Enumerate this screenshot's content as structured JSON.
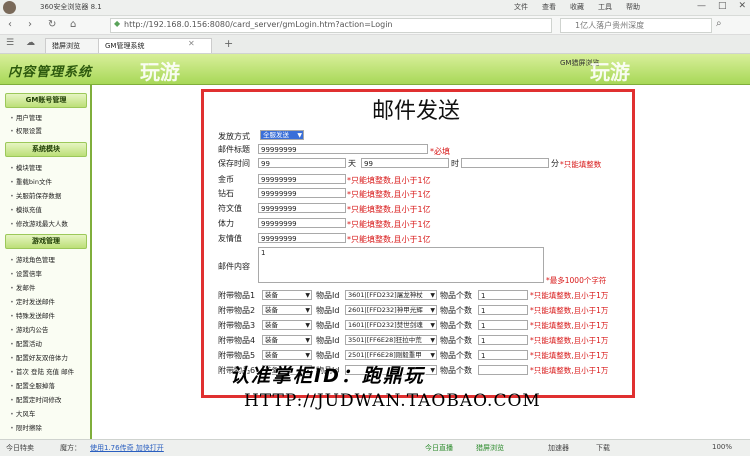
{
  "browser": {
    "title": "360安全浏览器 8.1",
    "menu": [
      "文件",
      "查看",
      "收藏",
      "工具",
      "帮助"
    ],
    "window_controls": [
      "—",
      "□",
      "✕"
    ],
    "url": "http://192.168.0.156:8080/card_server/gmLogin.htm?action=Login",
    "search_placeholder": "1亿人落户贵州深度",
    "tabs": [
      {
        "label": "猎屏浏览"
      },
      {
        "label": "GM管理系统"
      }
    ],
    "new_tab": "+",
    "tab_close": "✕",
    "nav": [
      "‹",
      "›",
      "↻"
    ]
  },
  "header": {
    "title": "内容管理系统",
    "right_text": "GM猎屏浏览",
    "watermark_left": "玩游",
    "watermark_right": "玩游"
  },
  "sidebar": {
    "sections": [
      {
        "title": "GM账号管理",
        "items": [
          "用户管理",
          "权限设置"
        ]
      },
      {
        "title": "系统模块",
        "items": [
          "模块管理",
          "重载bin文件",
          "关服前保存数据",
          "模拟充值",
          "修改游戏最大人数"
        ]
      },
      {
        "title": "游戏管理",
        "items": [
          "游戏角色管理",
          "设置倍率",
          "发邮件",
          "定时发送邮件",
          "特殊发送邮件",
          "游戏内公告",
          "配置活动",
          "配置好友双倍体力",
          "首次 登陆 充值 邮件",
          "配置全服掉落",
          "配置定时间修改",
          "大风车",
          "限时擦除"
        ]
      }
    ]
  },
  "form": {
    "title": "邮件发送",
    "send_mode": {
      "label": "发放方式",
      "value": "全服发送"
    },
    "subject": {
      "label": "邮件标题",
      "value": "99999999",
      "note": "*必填"
    },
    "duration": {
      "label": "保存时间",
      "days": "99",
      "days_unit": "天",
      "hours": "99",
      "hours_unit": "时",
      "minutes": "",
      "minutes_unit": "分",
      "note": "*只能填整数"
    },
    "fields": [
      {
        "label": "金币",
        "value": "99999999",
        "note": "*只能填整数,且小于1亿"
      },
      {
        "label": "钻石",
        "value": "99999999",
        "note": "*只能填整数,且小于1亿"
      },
      {
        "label": "符文值",
        "value": "99999999",
        "note": "*只能填整数,且小于1亿"
      },
      {
        "label": "体力",
        "value": "99999999",
        "note": "*只能填整数,且小于1亿"
      },
      {
        "label": "友情值",
        "value": "99999999",
        "note": "*只能填整数,且小于1亿"
      }
    ],
    "content": {
      "label": "邮件内容",
      "value": "1",
      "note": "*最多1000个字符"
    },
    "attachments": [
      {
        "label": "附带物品1",
        "type": "装备",
        "id_label": "物品Id",
        "item": "3601|[FFD232]屠龙神杖",
        "count_label": "物品个数",
        "count": "1",
        "note": "*只能填整数,且小于1万"
      },
      {
        "label": "附带物品2",
        "type": "装备",
        "id_label": "物品Id",
        "item": "2601|[FFD232]神甲光辉",
        "count_label": "物品个数",
        "count": "1",
        "note": "*只能填整数,且小于1万"
      },
      {
        "label": "附带物品3",
        "type": "装备",
        "id_label": "物品Id",
        "item": "1601|[FFD232]焚世剑魂",
        "count_label": "物品个数",
        "count": "1",
        "note": "*只能填整数,且小于1万"
      },
      {
        "label": "附带物品4",
        "type": "装备",
        "id_label": "物品Id",
        "item": "3501|[FF6E28]狂拉中荒",
        "count_label": "物品个数",
        "count": "1",
        "note": "*只能填整数,且小于1万"
      },
      {
        "label": "附带物品5",
        "type": "装备",
        "id_label": "物品Id",
        "item": "2501|[FF6E28]刚毅重甲",
        "count_label": "物品个数",
        "count": "1",
        "note": "*只能填整数,且小于1万"
      },
      {
        "label": "附带物品6",
        "type": "装备",
        "id_label": "物品Id",
        "item": "",
        "count_label": "物品个数",
        "count": "",
        "note": "*只能填整数,且小于1万"
      }
    ]
  },
  "watermark": {
    "text": "认准掌柜ID：跑鼎玩",
    "url": "HTTP://JUDWAN.TAOBAO.COM"
  },
  "statusbar": {
    "left1": "今日特卖",
    "left2": "魔方：",
    "link": "使用1.76传奇 加快打开",
    "mid1": "今日直播",
    "mid2": "猎屏浏览",
    "right1": "加速器",
    "right2": "下载",
    "zoom": "100%"
  }
}
